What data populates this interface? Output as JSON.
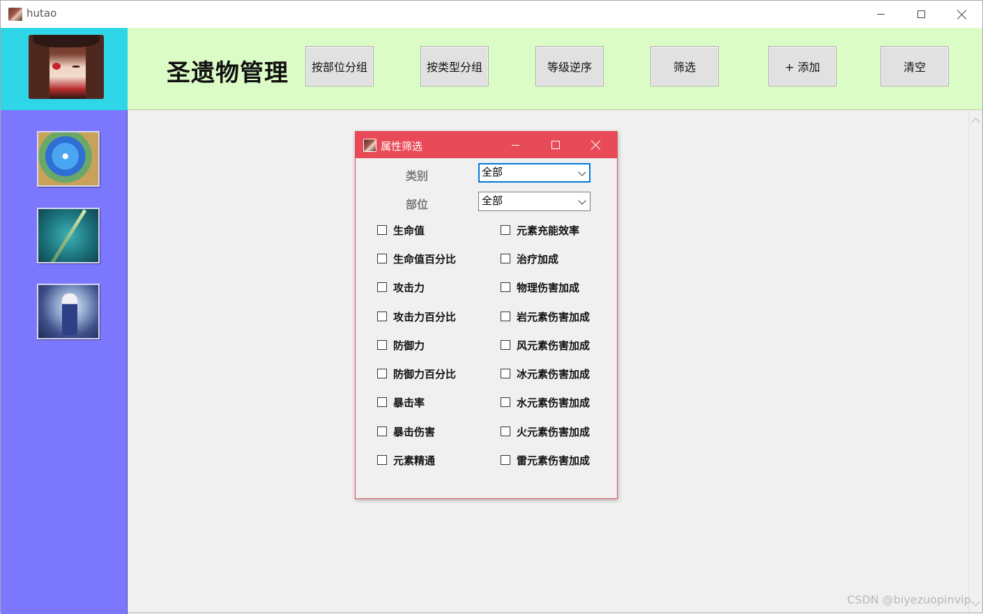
{
  "window": {
    "title": "hutao"
  },
  "header": {
    "title": "圣遗物管理",
    "buttons": [
      "按部位分组",
      "按类型分组",
      "等级逆序",
      "筛选",
      "+ 添加",
      "清空"
    ]
  },
  "sidebar": {
    "items": [
      {
        "icon": "flower-artifact-icon"
      },
      {
        "icon": "staff-weapon-icon"
      },
      {
        "icon": "character-portrait-icon"
      }
    ]
  },
  "dialog": {
    "title": "属性筛选",
    "category": {
      "label": "类别",
      "value": "全部"
    },
    "slot": {
      "label": "部位",
      "value": "全部"
    },
    "left_options": [
      "生命值",
      "生命值百分比",
      "攻击力",
      "攻击力百分比",
      "防御力",
      "防御力百分比",
      "暴击率",
      "暴击伤害",
      "元素精通"
    ],
    "right_options": [
      "元素充能效率",
      "治疗加成",
      "物理伤害加成",
      "岩元素伤害加成",
      "风元素伤害加成",
      "冰元素伤害加成",
      "水元素伤害加成",
      "火元素伤害加成",
      "雷元素伤害加成"
    ]
  },
  "watermark": "CSDN @biyezuopinvip",
  "colors": {
    "avatar_panel": "#2ed6e8",
    "header_bg": "#dcfcc7",
    "sidebar_bg": "#7b78fd",
    "dialog_titlebar": "#e84b57"
  }
}
